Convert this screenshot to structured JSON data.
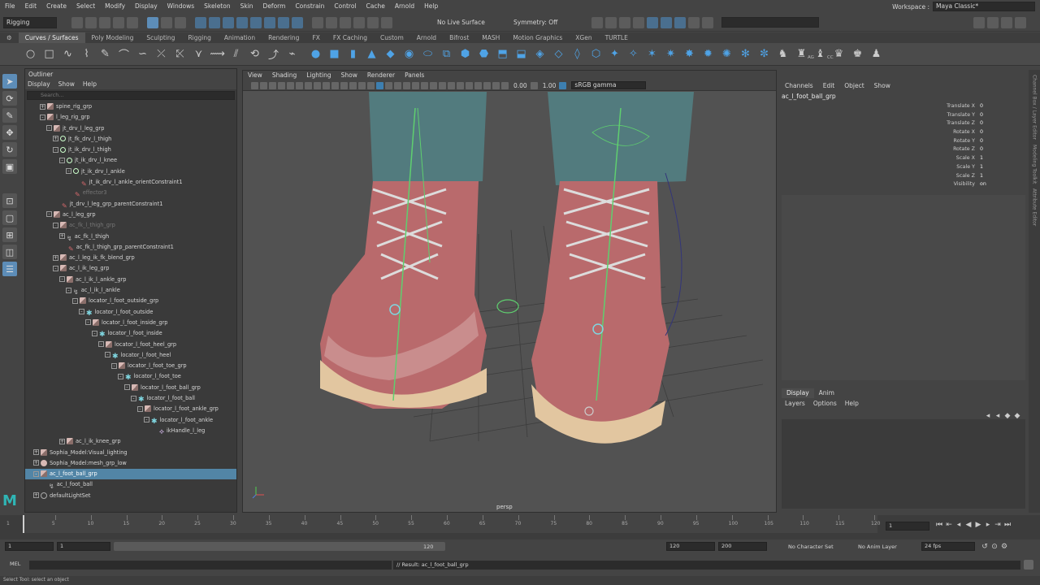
{
  "menubar": {
    "items": [
      "File",
      "Edit",
      "Create",
      "Select",
      "Modify",
      "Display",
      "Windows",
      "Skeleton",
      "Skin",
      "Deform",
      "Constrain",
      "Control",
      "Cache",
      "Arnold",
      "Help"
    ],
    "workspace_label": "Workspace :",
    "workspace_value": "Maya Classic*"
  },
  "statusline": {
    "menuset": "Rigging",
    "live_surface": "No Live Surface",
    "symmetry": "Symmetry: Off"
  },
  "shelf": {
    "tabs": [
      "Curves / Surfaces",
      "Poly Modeling",
      "Sculpting",
      "Rigging",
      "Animation",
      "Rendering",
      "FX",
      "FX Caching",
      "Custom",
      "Arnold",
      "Bifrost",
      "MASH",
      "Motion Graphics",
      "XGen",
      "TURTLE"
    ],
    "active_tab": "Curves / Surfaces",
    "labels_ag": "AG",
    "labels_cc": "CC"
  },
  "outliner": {
    "title": "Outliner",
    "menu": [
      "Display",
      "Show",
      "Help"
    ],
    "search_placeholder": "Search...",
    "rows": [
      {
        "label": "spine_rig_grp",
        "indent": 2,
        "icon": "grp",
        "exp": "+"
      },
      {
        "label": "l_leg_rig_grp",
        "indent": 2,
        "icon": "grp",
        "exp": "-"
      },
      {
        "label": "jt_drv_l_leg_grp",
        "indent": 3,
        "icon": "grp",
        "exp": "-"
      },
      {
        "label": "jt_fk_drv_l_thigh",
        "indent": 4,
        "icon": "jt",
        "exp": "+"
      },
      {
        "label": "jt_ik_drv_l_thigh",
        "indent": 4,
        "icon": "jt",
        "exp": "-"
      },
      {
        "label": "jt_ik_drv_l_knee",
        "indent": 5,
        "icon": "jt",
        "exp": "-"
      },
      {
        "label": "jt_ik_drv_l_ankle",
        "indent": 6,
        "icon": "jt",
        "exp": "-"
      },
      {
        "label": "jt_ik_drv_l_ankle_orientConstraint1",
        "indent": 7,
        "icon": "con",
        "exp": ""
      },
      {
        "label": "effector3",
        "indent": 6,
        "icon": "con",
        "exp": "",
        "dim": true
      },
      {
        "label": "jt_drv_l_leg_grp_parentConstraint1",
        "indent": 4,
        "icon": "con",
        "exp": ""
      },
      {
        "label": "ac_l_leg_grp",
        "indent": 3,
        "icon": "grp",
        "exp": "-"
      },
      {
        "label": "ac_fk_l_thigh_grp",
        "indent": 4,
        "icon": "grp",
        "exp": "-",
        "dim": true
      },
      {
        "label": "ac_fk_l_thigh",
        "indent": 5,
        "icon": "crv",
        "exp": "+"
      },
      {
        "label": "ac_fk_l_thigh_grp_parentConstraint1",
        "indent": 5,
        "icon": "con",
        "exp": ""
      },
      {
        "label": "ac_l_leg_ik_fk_blend_grp",
        "indent": 4,
        "icon": "grp",
        "exp": "+"
      },
      {
        "label": "ac_l_ik_leg_grp",
        "indent": 4,
        "icon": "grp",
        "exp": "-"
      },
      {
        "label": "ac_l_ik_l_ankle_grp",
        "indent": 5,
        "icon": "grp",
        "exp": "-"
      },
      {
        "label": "ac_l_ik_l_ankle",
        "indent": 6,
        "icon": "crv",
        "exp": "-"
      },
      {
        "label": "locator_l_foot_outside_grp",
        "indent": 7,
        "icon": "grp",
        "exp": "-"
      },
      {
        "label": "locator_l_foot_outside",
        "indent": 8,
        "icon": "loc",
        "exp": "-"
      },
      {
        "label": "locator_l_foot_inside_grp",
        "indent": 9,
        "icon": "grp",
        "exp": "-"
      },
      {
        "label": "locator_l_foot_inside",
        "indent": 10,
        "icon": "loc",
        "exp": "-"
      },
      {
        "label": "locator_l_foot_heel_grp",
        "indent": 11,
        "icon": "grp",
        "exp": "-"
      },
      {
        "label": "locator_l_foot_heel",
        "indent": 12,
        "icon": "loc",
        "exp": "-"
      },
      {
        "label": "locator_l_foot_toe_grp",
        "indent": 13,
        "icon": "grp",
        "exp": "-"
      },
      {
        "label": "locator_l_foot_toe",
        "indent": 14,
        "icon": "loc",
        "exp": "-"
      },
      {
        "label": "locator_l_foot_ball_grp",
        "indent": 15,
        "icon": "grp",
        "exp": "-"
      },
      {
        "label": "locator_l_foot_ball",
        "indent": 16,
        "icon": "loc",
        "exp": "-"
      },
      {
        "label": "locator_l_foot_ankle_grp",
        "indent": 17,
        "icon": "grp",
        "exp": "-"
      },
      {
        "label": "locator_l_foot_ankle",
        "indent": 18,
        "icon": "loc",
        "exp": "-"
      },
      {
        "label": "ikHandle_l_leg",
        "indent": 19,
        "icon": "ik",
        "exp": ""
      },
      {
        "label": "ac_l_ik_knee_grp",
        "indent": 5,
        "icon": "grp",
        "exp": "+"
      },
      {
        "label": "Sophia_Model:Visual_lighting",
        "indent": 1,
        "icon": "grp",
        "exp": "+"
      },
      {
        "label": "Sophia_Model:mesh_grp_low",
        "indent": 1,
        "icon": "mesh",
        "exp": "+"
      },
      {
        "label": "ac_l_foot_ball_grp",
        "indent": 1,
        "icon": "grp",
        "exp": "-",
        "sel": true
      },
      {
        "label": "ac_l_foot_ball",
        "indent": 2,
        "icon": "crv",
        "exp": ""
      },
      {
        "label": "defaultLightSet",
        "indent": 1,
        "icon": "set",
        "exp": "+"
      }
    ]
  },
  "viewport": {
    "menu": [
      "View",
      "Shading",
      "Lighting",
      "Show",
      "Renderer",
      "Panels"
    ],
    "near_value": "0.00",
    "far_value": "1.00",
    "colorspace": "sRGB gamma",
    "camera_label": "persp"
  },
  "channelbox": {
    "menu": [
      "Channels",
      "Edit",
      "Object",
      "Show"
    ],
    "object": "ac_l_foot_ball_grp",
    "channels": [
      {
        "name": "Translate X",
        "value": "0"
      },
      {
        "name": "Translate Y",
        "value": "0"
      },
      {
        "name": "Translate Z",
        "value": "0"
      },
      {
        "name": "Rotate X",
        "value": "0"
      },
      {
        "name": "Rotate Y",
        "value": "0"
      },
      {
        "name": "Rotate Z",
        "value": "0"
      },
      {
        "name": "Scale X",
        "value": "1"
      },
      {
        "name": "Scale Y",
        "value": "1"
      },
      {
        "name": "Scale Z",
        "value": "1"
      },
      {
        "name": "Visibility",
        "value": "on"
      }
    ]
  },
  "layers": {
    "tabs": [
      "Display",
      "Anim"
    ],
    "active_tab": "Display",
    "menu": [
      "Layers",
      "Options",
      "Help"
    ]
  },
  "side_strip": [
    "Channel Box / Layer Editor",
    "Modeling Toolkit",
    "Attribute Editor"
  ],
  "timeslider": {
    "ticks": [
      "5",
      "10",
      "15",
      "20",
      "25",
      "30",
      "35",
      "40",
      "45",
      "50",
      "55",
      "60",
      "65",
      "70",
      "75",
      "80",
      "85",
      "90",
      "95",
      "100",
      "105",
      "110",
      "115",
      "120"
    ],
    "current_frame": "1"
  },
  "range": {
    "start": "1",
    "inner_start": "1",
    "inner_end": "120",
    "end": "120",
    "anim_end": "200",
    "character_set": "No Character Set",
    "anim_layer": "No Anim Layer",
    "fps": "24 fps"
  },
  "cmdline": {
    "lang": "MEL",
    "result": "// Result: ac_l_foot_ball_grp"
  },
  "helpline": "Select Tool: select an object"
}
